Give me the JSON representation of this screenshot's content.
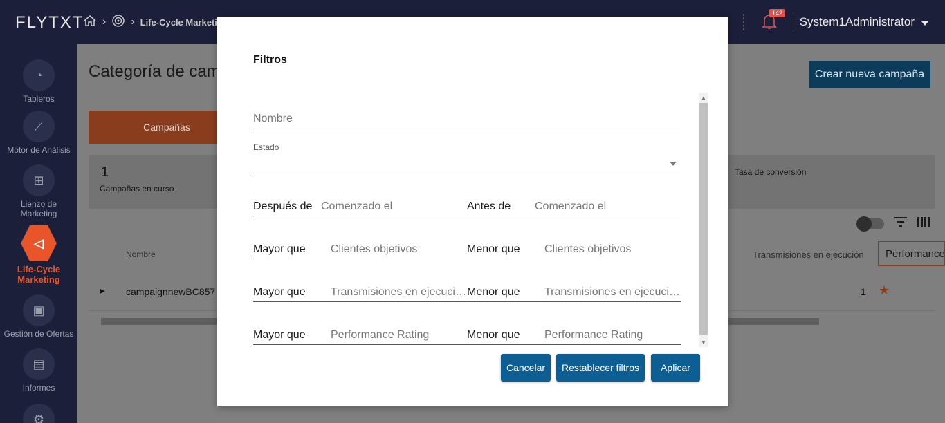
{
  "app": {
    "logo": "FLYTXT",
    "breadcrumb": [
      "Life-Cycle Marketing"
    ],
    "user_name": "System1Administrator",
    "notification_count": "142"
  },
  "sidebar": {
    "items": [
      {
        "label": "Tableros",
        "icon": "dashboard-icon"
      },
      {
        "label": "Motor de Análisis",
        "icon": "analytics-icon"
      },
      {
        "label": "Lienzo de Marketing",
        "icon": "canvas-icon"
      },
      {
        "label": "Life-Cycle Marketing",
        "icon": "megaphone-icon",
        "active": true
      },
      {
        "label": "Gestión de Ofertas",
        "icon": "gift-icon"
      },
      {
        "label": "Informes",
        "icon": "report-icon"
      }
    ]
  },
  "page": {
    "title": "Categoría de cam",
    "create_button": "Crear nueva campaña",
    "tab": "Campañas",
    "stat_value": "1",
    "stat_label": "Campañas en curso",
    "stat_conversion": "Tasa de conversión",
    "table": {
      "col_nombre": "Nombre",
      "col_transmisiones": "Transmisiones en ejecución",
      "col_performance": "Performance Rating",
      "rows": [
        {
          "nombre": "campaignnewBC857",
          "transmisiones": "1"
        }
      ]
    }
  },
  "modal": {
    "title": "Filtros",
    "nombre_placeholder": "Nombre",
    "estado_label": "Estado",
    "despues_label": "Después de",
    "despues_placeholder": "Comenzado el",
    "antes_label": "Antes de",
    "antes_placeholder": "Comenzado el",
    "mayor_label": "Mayor que",
    "menor_label": "Menor que",
    "clientes_placeholder": "Clientes objetivos",
    "transmisiones_placeholder": "Transmisiones en ejecución",
    "performance_placeholder": "Performance Rating",
    "cancel_button": "Cancelar",
    "reset_button": "Restablecer filtros",
    "apply_button": "Aplicar"
  },
  "colors": {
    "accent": "#0d5f93",
    "brand_orange": "#e8552a",
    "topbar": "#1b1f3a"
  }
}
